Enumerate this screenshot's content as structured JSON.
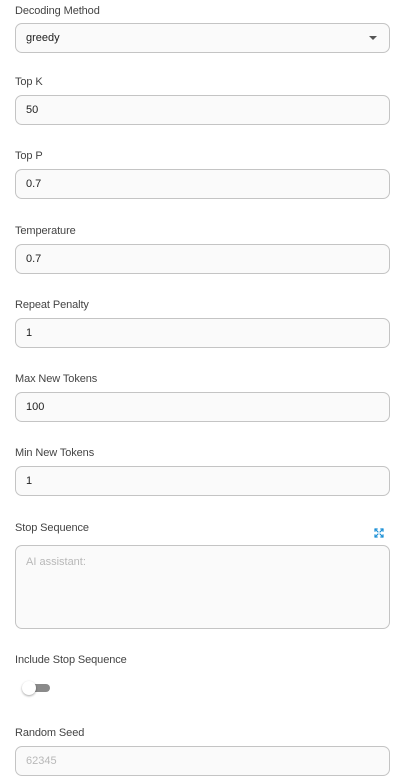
{
  "decoding_method": {
    "label": "Decoding Method",
    "value": "greedy"
  },
  "top_k": {
    "label": "Top K",
    "value": "50"
  },
  "top_p": {
    "label": "Top P",
    "value": "0.7"
  },
  "temperature": {
    "label": "Temperature",
    "value": "0.7"
  },
  "repeat_penalty": {
    "label": "Repeat Penalty",
    "value": "1"
  },
  "max_new_tokens": {
    "label": "Max New Tokens",
    "value": "100"
  },
  "min_new_tokens": {
    "label": "Min New Tokens",
    "value": "1"
  },
  "stop_sequence": {
    "label": "Stop Sequence",
    "placeholder": "AI assistant:",
    "expand_icon": "expand-arrows-icon"
  },
  "include_stop_sequence": {
    "label": "Include Stop Sequence",
    "enabled": false
  },
  "random_seed": {
    "label": "Random Seed",
    "placeholder": "62345"
  },
  "colors": {
    "accent": "#1a8fd6",
    "border": "#c4c4c4",
    "toggle_track": "#8a8a8a"
  }
}
